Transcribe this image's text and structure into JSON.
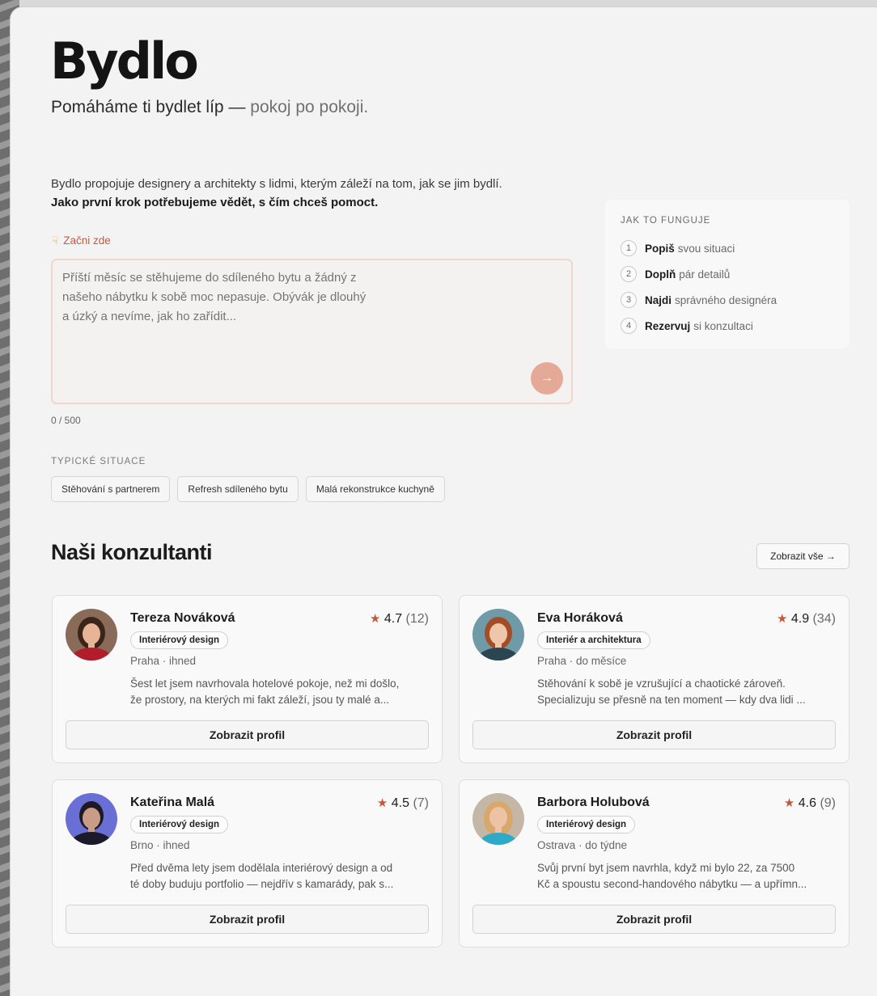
{
  "brand": "Bydlo",
  "tagline": {
    "main": "Pomáháme ti bydlet líp —",
    "muted": " pokoj po pokoji."
  },
  "intro": {
    "line1": "Bydlo propojuje designery a architekty s lidmi, kterým záleží na tom, jak se jim bydlí.",
    "line2": "Jako první krok potřebujeme vědět, s čím chceš pomoct."
  },
  "start_label": "Začni zde",
  "textarea": {
    "placeholder": "Příští měsíc se stěhujeme do sdíleného bytu a žádný z\nnašeho nábytku k sobě moc nepasuje. Obývák je dlouhý\na úzký a nevíme, jak ho zařídit...",
    "value": ""
  },
  "send_icon": "→",
  "counter": "0 / 500",
  "typical": {
    "label": "TYPICKÉ SITUACE",
    "chips": [
      "Stěhování s partnerem",
      "Refresh sdíleného bytu",
      "Malá rekonstrukce kuchyně"
    ]
  },
  "how": {
    "title": "JAK TO FUNGUJE",
    "steps": [
      {
        "num": "1",
        "bold": "Popiš",
        "rest": "svou situaci"
      },
      {
        "num": "2",
        "bold": "Doplň",
        "rest": "pár detailů"
      },
      {
        "num": "3",
        "bold": "Najdi",
        "rest": "správného designéra"
      },
      {
        "num": "4",
        "bold": "Rezervuj",
        "rest": "si konzultaci"
      }
    ]
  },
  "consultants": {
    "title": "Naši konzultanti",
    "view_all": "Zobrazit vše →",
    "items": [
      {
        "name": "Tereza Nováková",
        "rating": "4.7",
        "count": "(12)",
        "badge": "Interiérový design",
        "location": "Praha · ihned",
        "bio1": "Šest let jsem navrhovala hotelové pokoje, než mi došlo,",
        "bio2": "že prostory, na kterých mi fakt záleží, jsou ty malé a...",
        "button": "Zobrazit profil",
        "avatar_colors": {
          "bg": "#8a6a58",
          "skin": "#e8b497",
          "hair": "#3b2419",
          "top": "#b11d2a"
        }
      },
      {
        "name": "Eva Horáková",
        "rating": "4.9",
        "count": "(34)",
        "badge": "Interiér a architektura",
        "location": "Praha · do měsíce",
        "bio1": "Stěhování k sobě je vzrušující a chaotické zároveň.",
        "bio2": "Specializuju se přesně na ten moment — kdy dva lidi ...",
        "button": "Zobrazit profil",
        "avatar_colors": {
          "bg": "#6f9aa7",
          "skin": "#f0c6ab",
          "hair": "#a44c27",
          "top": "#2c4651"
        }
      },
      {
        "name": "Kateřina Malá",
        "rating": "4.5",
        "count": "(7)",
        "badge": "Interiérový design",
        "location": "Brno · ihned",
        "bio1": "Před dvěma lety jsem dodělala interiérový design a od",
        "bio2": "té doby buduju portfolio — nejdřív s kamarády, pak s...",
        "button": "Zobrazit profil",
        "avatar_colors": {
          "bg": "#6a6fd6",
          "skin": "#c89c86",
          "hair": "#1e1a24",
          "top": "#1a1a2a"
        }
      },
      {
        "name": "Barbora Holubová",
        "rating": "4.6",
        "count": "(9)",
        "badge": "Interiérový design",
        "location": "Ostrava · do týdne",
        "bio1": "Svůj první byt jsem navrhla, když mi bylo 22, za 7500",
        "bio2": "Kč a spoustu second-handového nábytku — a upřímn...",
        "button": "Zobrazit profil",
        "avatar_colors": {
          "bg": "#c4b7a6",
          "skin": "#eec2a4",
          "hair": "#d8a86a",
          "top": "#2fa9c8"
        }
      }
    ]
  }
}
